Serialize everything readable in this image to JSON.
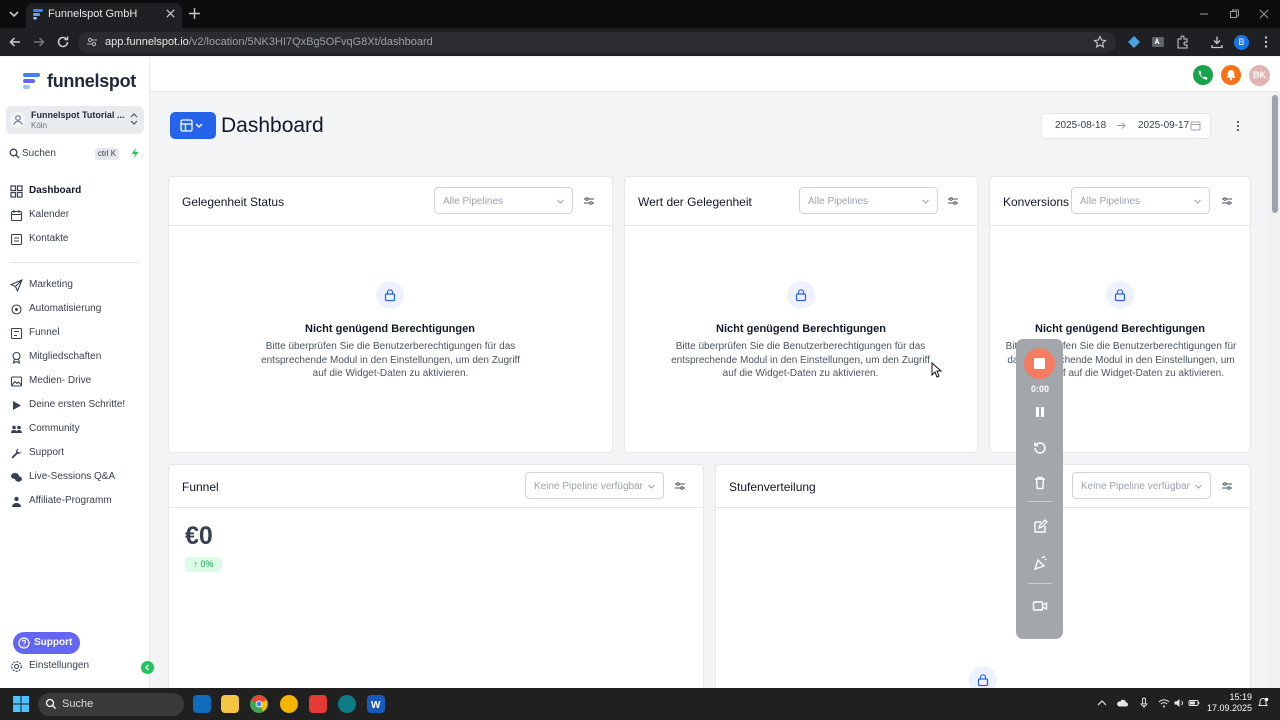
{
  "browser": {
    "tab_title": "Funnelspot GmbH",
    "url_host": "app.funnelspot.io",
    "url_path": "/v2/location/5NK3HI7QxBg5OFvqG8Xt/dashboard",
    "profile_initial": "B"
  },
  "app": {
    "brand": "funnelspot",
    "account": {
      "name": "Funnelspot Tutorial ...",
      "location": "Köln"
    },
    "search": {
      "label": "Suchen",
      "shortcut": "ctrl K"
    },
    "nav_main": [
      {
        "label": "Dashboard",
        "icon": "grid-icon",
        "active": true
      },
      {
        "label": "Kalender",
        "icon": "calendar-icon"
      },
      {
        "label": "Kontakte",
        "icon": "contacts-icon"
      }
    ],
    "nav_secondary": [
      {
        "label": "Marketing",
        "icon": "send-icon"
      },
      {
        "label": "Automatisierung",
        "icon": "automation-icon"
      },
      {
        "label": "Funnel",
        "icon": "funnel-icon"
      },
      {
        "label": "Mitgliedschaften",
        "icon": "membership-icon"
      },
      {
        "label": "Medien- Drive",
        "icon": "media-icon"
      },
      {
        "label": "Deine ersten Schritte!",
        "icon": "play-icon"
      },
      {
        "label": "Community",
        "icon": "community-icon"
      },
      {
        "label": "Support",
        "icon": "wrench-icon"
      },
      {
        "label": "Live-Sessions Q&A",
        "icon": "chat-icon"
      },
      {
        "label": "Affiliate-Programm",
        "icon": "affiliate-icon"
      }
    ],
    "support_button": "Support",
    "settings_label": "Einstellungen",
    "user_initials": "BK",
    "colors": {
      "primary": "#2563eb",
      "accent_green": "#22c55e",
      "support": "#6366f1",
      "notify": "#f97316"
    }
  },
  "dashboard": {
    "title": "Dashboard",
    "date_from": "2025-08-18",
    "date_to": "2025-09-17",
    "cards": [
      {
        "title": "Gelegenheit Status",
        "select": "Alle Pipelines"
      },
      {
        "title": "Wert der Gelegenheit",
        "select": "Alle Pipelines"
      },
      {
        "title": "Konversions",
        "select": "Alle Pipelines"
      }
    ],
    "no_permission_title": "Nicht genügend Berechtigungen",
    "no_permission_text": "Bitte überprüfen Sie die Benutzerberechtigungen für das entsprechende Modul in den Einstellungen, um den Zugriff auf die Widget-Daten zu aktivieren.",
    "funnel": {
      "title": "Funnel",
      "select": "Keine Pipeline verfügbar",
      "amount": "€0",
      "change": "0%"
    },
    "stage": {
      "title": "Stufenverteilung",
      "select": "Keine Pipeline verfügbar"
    }
  },
  "recorder": {
    "time": "0:00"
  },
  "taskbar": {
    "search": "Suche",
    "time": "15:19",
    "date": "17.09.2025"
  }
}
